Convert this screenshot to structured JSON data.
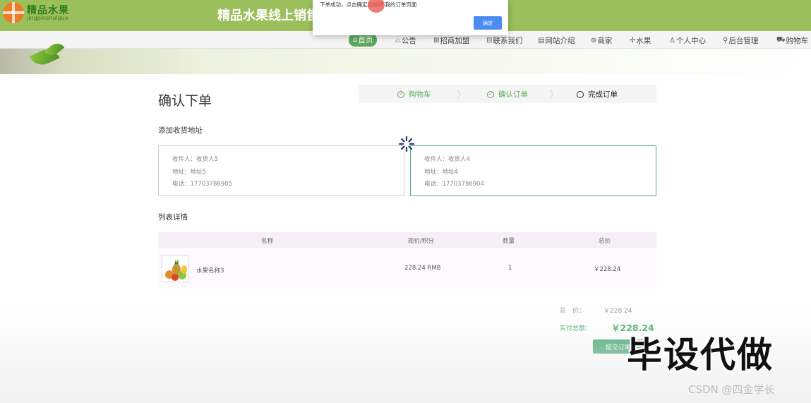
{
  "header": {
    "logo_text": "精品水果",
    "logo_sub": "jingpinshuiguo",
    "site_title": "精品水果线上销售"
  },
  "nav": [
    {
      "label": "首页",
      "icon": "home-icon",
      "glyph": "⌂"
    },
    {
      "label": "公告",
      "icon": "notice-icon",
      "glyph": "⌓"
    },
    {
      "label": "招商加盟",
      "icon": "handshake-icon",
      "glyph": "⊞"
    },
    {
      "label": "联系我们",
      "icon": "contact-icon",
      "glyph": "⊟"
    },
    {
      "label": "网站介绍",
      "icon": "info-icon",
      "glyph": "▤"
    },
    {
      "label": "商家",
      "icon": "shop-icon",
      "glyph": "⊚"
    },
    {
      "label": "水果",
      "icon": "fruit-icon",
      "glyph": "✢"
    },
    {
      "label": "个人中心",
      "icon": "user-icon",
      "glyph": "♙"
    },
    {
      "label": "后台管理",
      "icon": "link-icon",
      "glyph": "⚲"
    },
    {
      "label": "购物车",
      "icon": "cart-icon",
      "glyph": "⛟"
    }
  ],
  "page": {
    "title": "确认下单",
    "steps": [
      {
        "label": "购物车",
        "status": "done"
      },
      {
        "label": "确认订单",
        "status": "done"
      },
      {
        "label": "完成订单",
        "status": "current"
      }
    ],
    "address_section_label": "添加收货地址",
    "addresses": [
      {
        "receiver": "收件人：收货人5",
        "address": "地址：地址5",
        "phone": "电话：17703786905",
        "selected": false
      },
      {
        "receiver": "收件人：收货人4",
        "address": "地址：地址4",
        "phone": "电话：17703786904",
        "selected": true
      }
    ],
    "list_section_label": "列表详情",
    "table": {
      "headers": [
        "名称",
        "现价/积分",
        "数量",
        "总价"
      ],
      "rows": [
        {
          "name": "水果名称3",
          "price": "228.24 RMB",
          "quantity": "1",
          "total": "￥228.24"
        }
      ]
    },
    "summary": {
      "total_label": "总　价：",
      "total_value": "￥228.24",
      "paid_label": "实付总额：",
      "paid_value": "￥228.24"
    },
    "submit_label": "提交订单"
  },
  "dialog": {
    "message": "下单成功，点击确定后跳转 我的订单页面",
    "ok_label": "确定"
  },
  "overlay": {
    "watermark": "毕设代做",
    "credit": "CSDN @四金学长"
  },
  "colors": {
    "header_green": "#9bbf5a",
    "accent_green": "#5aa85a",
    "selected_border": "#4cae8d",
    "submit_green": "#3ea66c",
    "dialog_button": "#4b8cf0"
  }
}
